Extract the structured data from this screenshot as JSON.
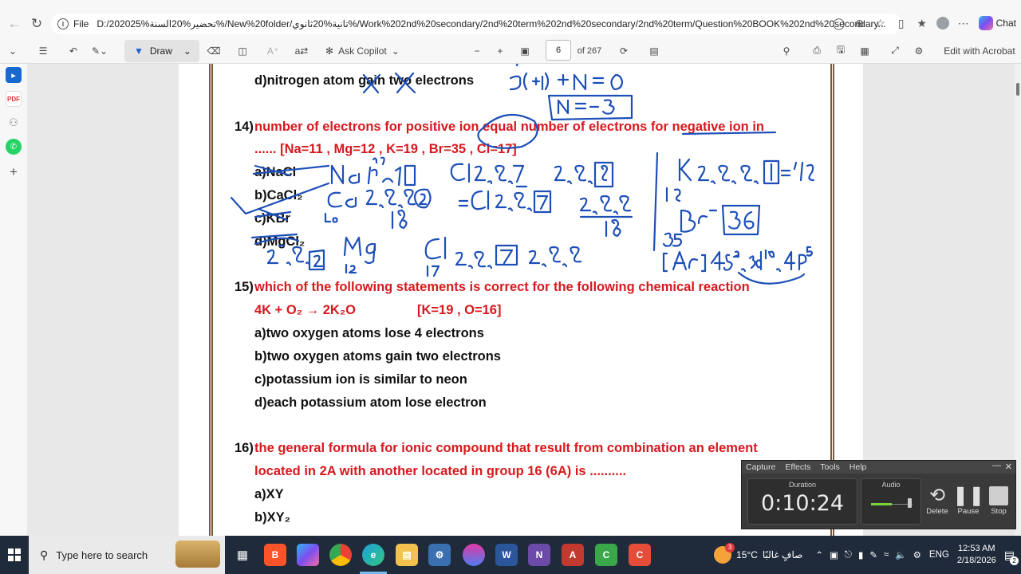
{
  "browser": {
    "back_icon": "arrow-left-icon",
    "file_label": "File",
    "url": "D:/202025%تحضير%20السنة%/New%20folder/تانية%20ثانوي%/Work%202nd%20secondary/2nd%20term%202nd%20secondary/2nd%20term/Question%20BOOK%202nd%20secondary...",
    "chat_label": "Chat"
  },
  "toolbar": {
    "draw_label": "Draw",
    "ask_copilot_label": "Ask Copilot",
    "page_current": "6",
    "page_total": "of 267",
    "edit_acrobat_label": "Edit with Acrobat"
  },
  "document": {
    "q13d": "d)nitrogen atom gain two electrons",
    "q14_num": "14)",
    "q14_line1": "number of electrons for positive ion equal number of electrons for negative ion in",
    "q14_line2": "...... [Na=11 , Mg=12 , K=19 , Br=35 , Cl=17]",
    "q14_a": "a)NaCl",
    "q14_b": "b)CaCl₂",
    "q14_c": "c)KBr",
    "q14_d": "d)MgCl₂",
    "q15_num": "15)",
    "q15_line1": "which of the following statements is correct for the following chemical reaction",
    "q15_eq": "4K + O₂ → 2K₂O",
    "q15_data": "[K=19 , O=16]",
    "q15_a": "a)two oxygen atoms lose 4 electrons",
    "q15_b": "b)two oxygen atoms gain two electrons",
    "q15_c": "c)potassium ion is similar to neon",
    "q15_d": "d)each potassium atom lose electron",
    "q16_num": "16)",
    "q16_line1": "the general formula for ionic compound that result from combination an element",
    "q16_line2": "located in 2A with another located in group 16 (6A) is ..........",
    "q16_a": "a)XY",
    "q16_b": "b)XY₂"
  },
  "capture": {
    "menu": [
      "Capture",
      "Effects",
      "Tools",
      "Help"
    ],
    "duration_label": "Duration",
    "duration_value": "0:10:24",
    "audio_label": "Audio",
    "delete_label": "Delete",
    "pause_label": "Pause",
    "stop_label": "Stop"
  },
  "taskbar": {
    "search_placeholder": "Type here to search",
    "weather_temp": "15°C",
    "weather_text": "صافٍ غالبًا",
    "weather_badge": "3",
    "lang": "ENG",
    "time": "12:53 AM",
    "date": "2/18/2026",
    "notif_count": "2"
  }
}
